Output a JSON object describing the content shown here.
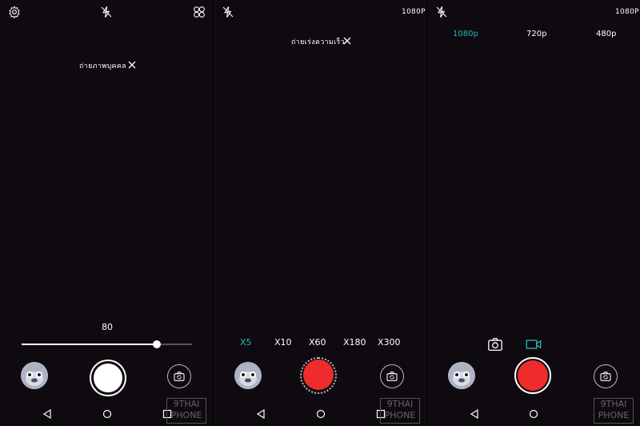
{
  "panel1": {
    "mode_banner": "ถ่ายภาพบุคคล",
    "slider_value": "80",
    "slider_level": 0.8
  },
  "panel2": {
    "resolution": "1080P",
    "mode_banner": "ถ่ายเร่งความเร็ว",
    "speed_options": [
      "X5",
      "X10",
      "X60",
      "X180",
      "X300"
    ],
    "selected_speed": "X5"
  },
  "panel3": {
    "resolution": "1080P",
    "resolution_options": [
      "1080p",
      "720p",
      "480p"
    ],
    "selected_resolution": "1080p"
  },
  "watermark": {
    "line1": "9THAI",
    "line2": "PHONE"
  },
  "colors": {
    "accent": "#22b8b8",
    "record": "#ee2c2c",
    "background": "#0e0a0f"
  },
  "icons": [
    "settings-icon",
    "flash-off-icon",
    "filter-icon",
    "close-icon",
    "camera-icon",
    "video-icon",
    "switch-camera-icon",
    "nav-back-icon",
    "nav-home-icon",
    "nav-recents-icon"
  ]
}
